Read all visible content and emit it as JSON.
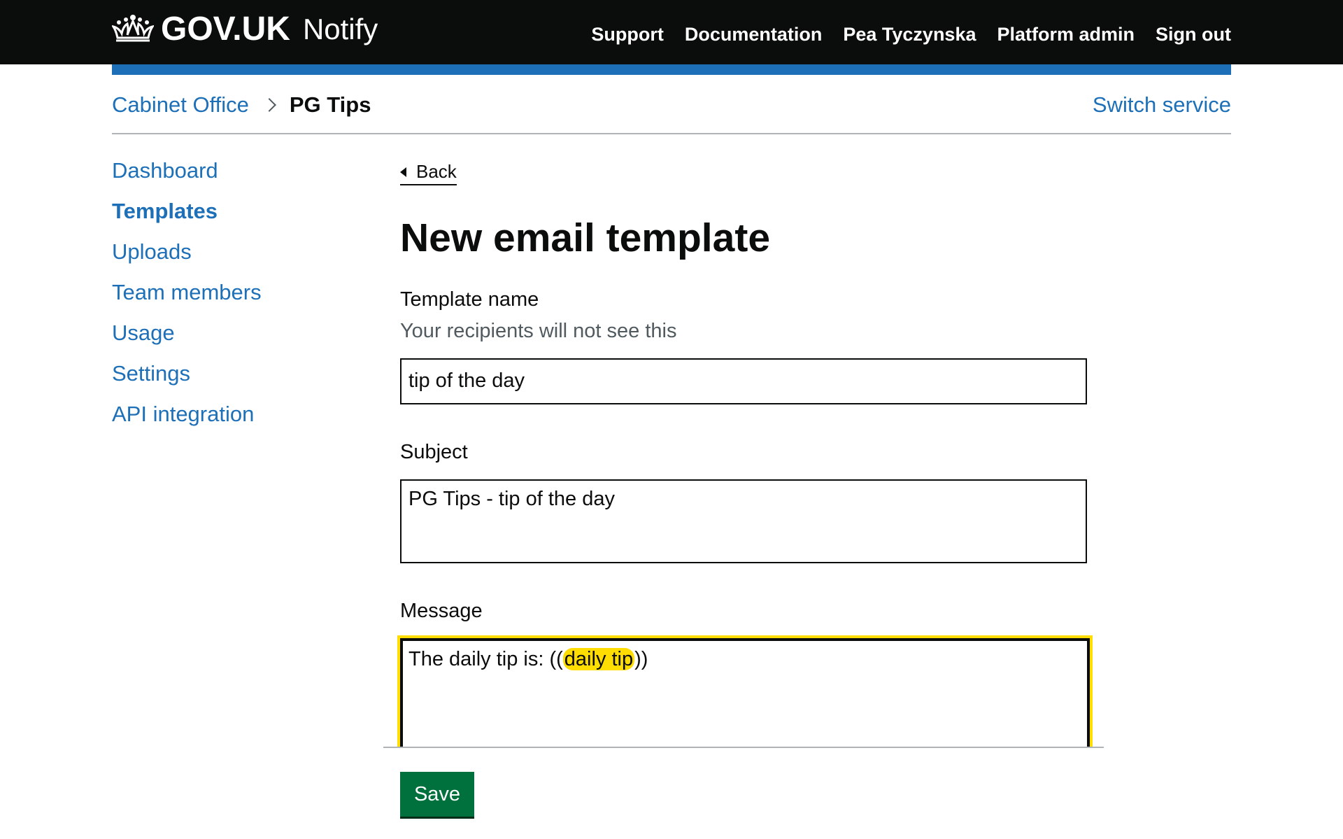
{
  "header": {
    "logo_text": "GOV.UK",
    "product_name": "Notify",
    "nav": [
      "Support",
      "Documentation",
      "Pea Tyczynska",
      "Platform admin",
      "Sign out"
    ]
  },
  "breadcrumb": {
    "organisation": "Cabinet Office",
    "service": "PG Tips",
    "switch_label": "Switch service"
  },
  "sidebar": {
    "items": [
      {
        "label": "Dashboard",
        "active": false
      },
      {
        "label": "Templates",
        "active": true
      },
      {
        "label": "Uploads",
        "active": false
      },
      {
        "label": "Team members",
        "active": false
      },
      {
        "label": "Usage",
        "active": false
      },
      {
        "label": "Settings",
        "active": false
      },
      {
        "label": "API integration",
        "active": false
      }
    ]
  },
  "main": {
    "back_label": "Back",
    "title": "New email template",
    "template_name": {
      "label": "Template name",
      "hint": "Your recipients will not see this",
      "value": "tip of the day"
    },
    "subject": {
      "label": "Subject",
      "value": "PG Tips - tip of the day"
    },
    "message": {
      "label": "Message",
      "prefix": "The daily tip is: ((",
      "placeholder": "daily tip",
      "suffix": "))"
    },
    "save_label": "Save"
  },
  "colors": {
    "header_bg": "#0b0c0c",
    "brand_blue": "#1d70b8",
    "link": "#1d70b8",
    "focus_yellow": "#ffdd00",
    "button_green": "#00703c",
    "hint_grey": "#505a5f"
  },
  "icons": [
    "crown-icon",
    "chevron-right-icon",
    "back-arrow-icon"
  ]
}
